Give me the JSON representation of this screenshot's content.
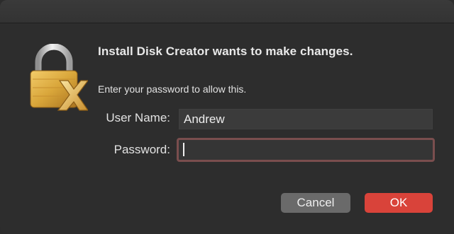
{
  "dialog": {
    "title": "Install Disk Creator wants to make changes.",
    "subtitle": "Enter your password to allow this.",
    "icon": "lock-icon"
  },
  "form": {
    "username_label": "User Name:",
    "username_value": "Andrew",
    "password_label": "Password:",
    "password_value": ""
  },
  "buttons": {
    "cancel_label": "Cancel",
    "ok_label": "OK"
  },
  "colors": {
    "background": "#2d2d2d",
    "ok_button": "#d9433a",
    "cancel_button": "#6a6a6a",
    "focus_ring": "#7a4e4e",
    "lock_gold": "#d9a63a"
  }
}
